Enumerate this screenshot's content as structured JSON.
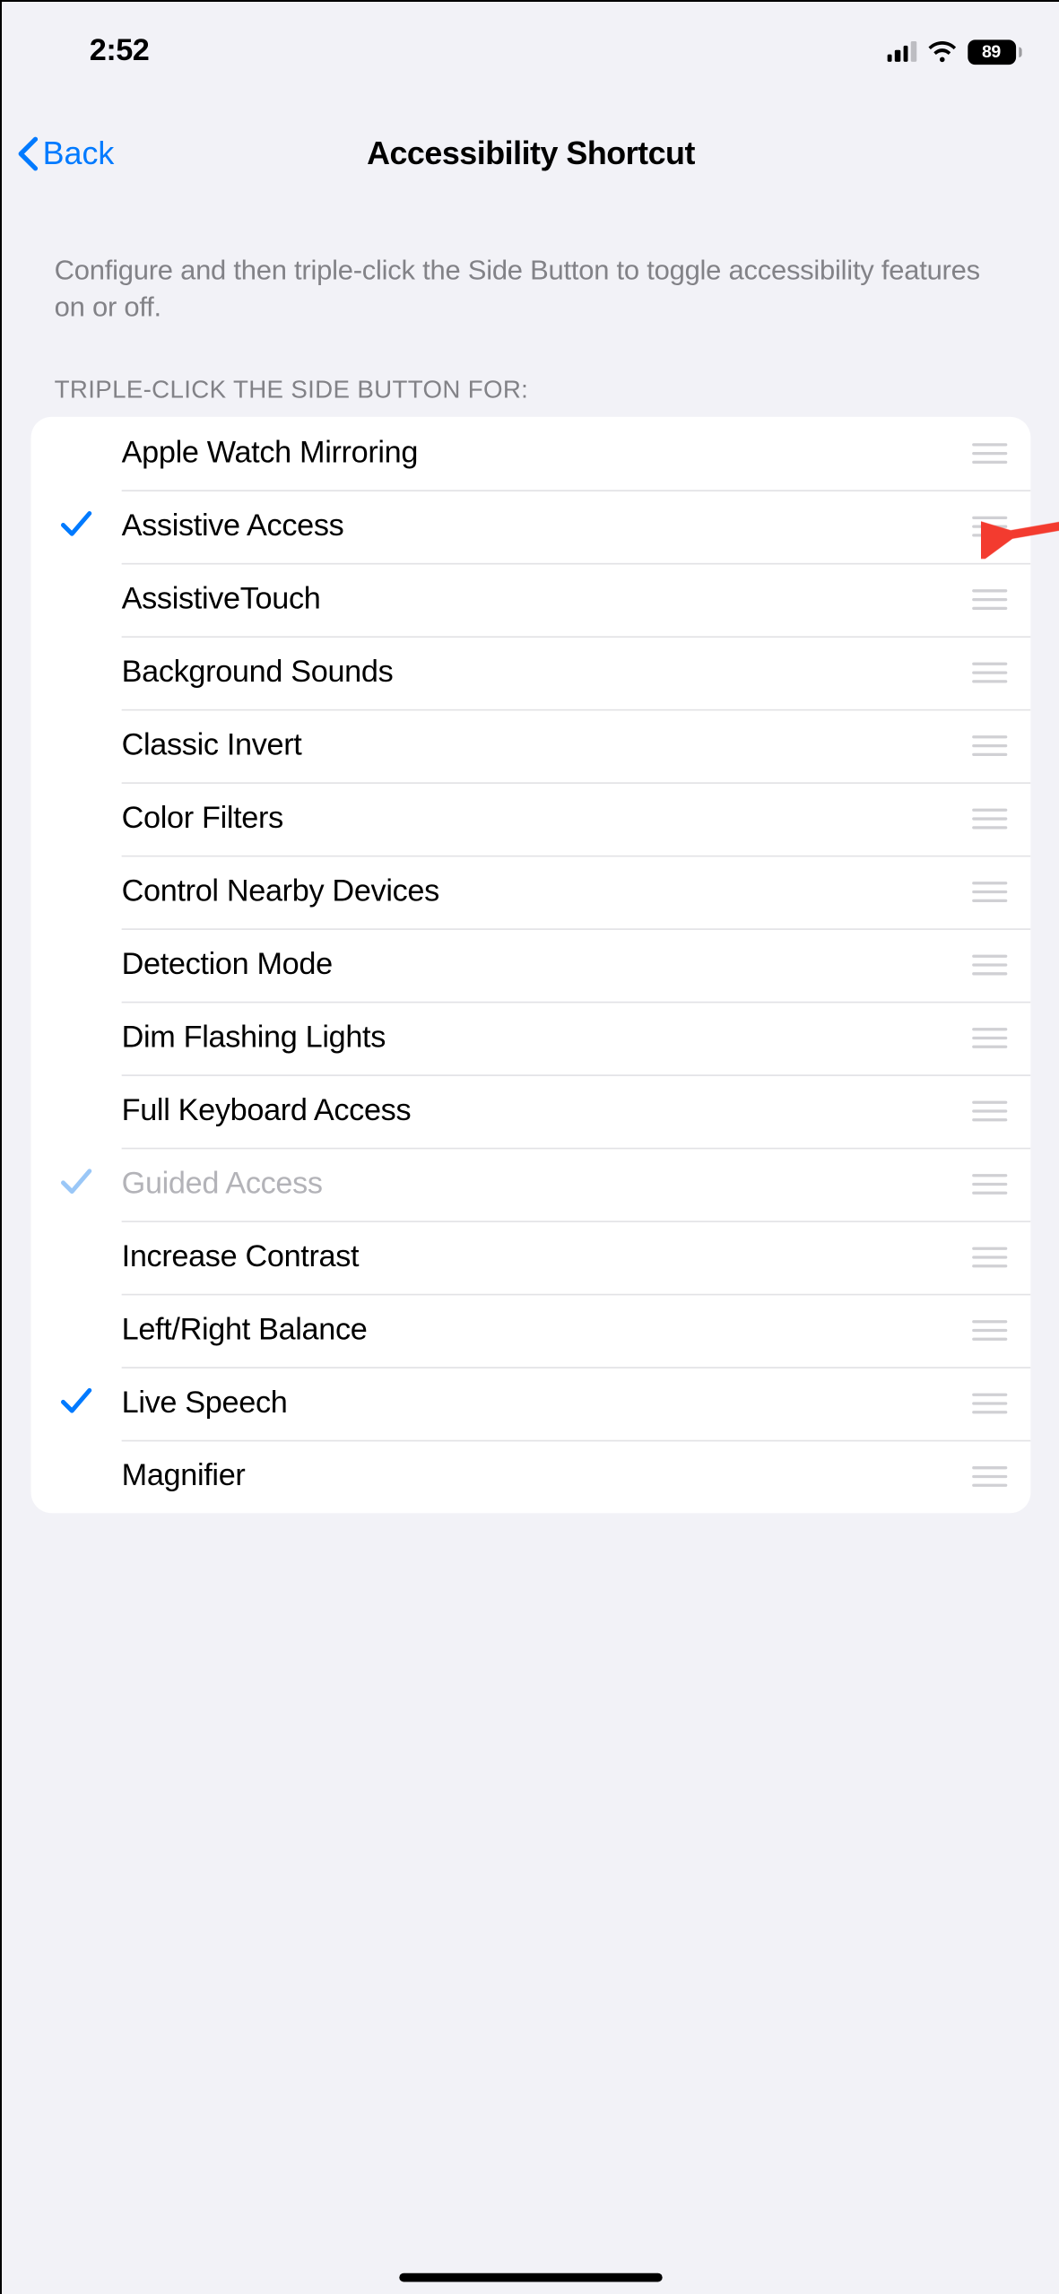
{
  "status": {
    "time": "2:52",
    "battery_pct": "89"
  },
  "nav": {
    "back_label": "Back",
    "title": "Accessibility Shortcut"
  },
  "intro_text": "Configure and then triple-click the Side Button to toggle accessibility features on or off.",
  "section_header": "TRIPLE-CLICK THE SIDE BUTTON FOR:",
  "items": [
    {
      "label": "Apple Watch Mirroring",
      "checked": false,
      "disabled": false
    },
    {
      "label": "Assistive Access",
      "checked": true,
      "disabled": false
    },
    {
      "label": "AssistiveTouch",
      "checked": false,
      "disabled": false
    },
    {
      "label": "Background Sounds",
      "checked": false,
      "disabled": false
    },
    {
      "label": "Classic Invert",
      "checked": false,
      "disabled": false
    },
    {
      "label": "Color Filters",
      "checked": false,
      "disabled": false
    },
    {
      "label": "Control Nearby Devices",
      "checked": false,
      "disabled": false
    },
    {
      "label": "Detection Mode",
      "checked": false,
      "disabled": false
    },
    {
      "label": "Dim Flashing Lights",
      "checked": false,
      "disabled": false
    },
    {
      "label": "Full Keyboard Access",
      "checked": false,
      "disabled": false
    },
    {
      "label": "Guided Access",
      "checked": true,
      "disabled": true
    },
    {
      "label": "Increase Contrast",
      "checked": false,
      "disabled": false
    },
    {
      "label": "Left/Right Balance",
      "checked": false,
      "disabled": false
    },
    {
      "label": "Live Speech",
      "checked": true,
      "disabled": false
    },
    {
      "label": "Magnifier",
      "checked": false,
      "disabled": false
    }
  ],
  "annotation": {
    "target_index": 1
  }
}
